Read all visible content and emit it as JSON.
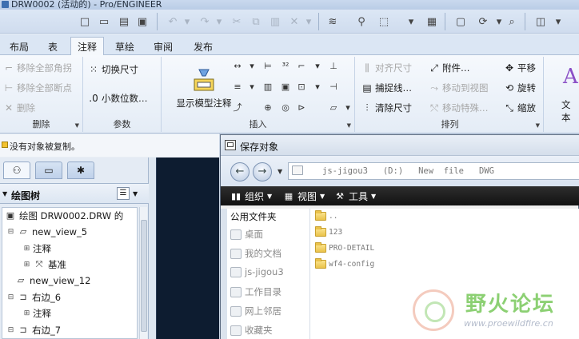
{
  "window": {
    "title": "DRW0002 (活动的) - Pro/ENGINEER"
  },
  "ribbon_tabs": [
    "布局",
    "表",
    "注释",
    "草绘",
    "审阅",
    "发布"
  ],
  "groups": {
    "delete": {
      "label": "删除",
      "items": [
        "移除全部角拐",
        "移除全部断点",
        "删除"
      ]
    },
    "params": {
      "label": "参数",
      "items": [
        "切换尺寸",
        "小数位数…"
      ]
    },
    "insert": {
      "label": "插入",
      "big_button": "显示模型注释"
    },
    "arrange": {
      "label": "排列",
      "items": [
        "对齐尺寸",
        "附件…",
        "平移",
        "捕捉线…",
        "移动到视图",
        "旋转",
        "清除尺寸",
        "移动特殊…",
        "缩放"
      ]
    },
    "partial_text": "文本"
  },
  "status": {
    "message": "没有对象被复制。"
  },
  "model_tree": {
    "header": "绘图树",
    "nodes": [
      {
        "label": "绘图 DRW0002.DRW 的",
        "level": 0
      },
      {
        "label": "new_view_5",
        "level": 1
      },
      {
        "label": "注释",
        "level": 2
      },
      {
        "label": "基准",
        "level": 2
      },
      {
        "label": "new_view_12",
        "level": 1
      },
      {
        "label": "右边_6",
        "level": 1
      },
      {
        "label": "注释",
        "level": 2
      },
      {
        "label": "右边_7",
        "level": 1
      }
    ]
  },
  "dialog": {
    "title": "保存对象",
    "address_path": "js-jigou3   (D:)   New  file   DWG",
    "commands": {
      "organize": "组织",
      "views": "视图",
      "tools": "工具"
    },
    "nav_pane": {
      "header": "公用文件夹",
      "items": [
        "桌面",
        "我的文档",
        "js-jigou3",
        "工作目录",
        "网上邻居",
        "收藏夹"
      ]
    },
    "files": [
      "..",
      "123",
      "PRO-DETAIL",
      "wf4-config"
    ]
  },
  "watermark": {
    "text": "野火论坛",
    "url": "www.proewildfire.cn"
  },
  "colors": {
    "accent": "#3d6fb0",
    "canvas": "#0d1c30",
    "command_bar": "#121212"
  }
}
